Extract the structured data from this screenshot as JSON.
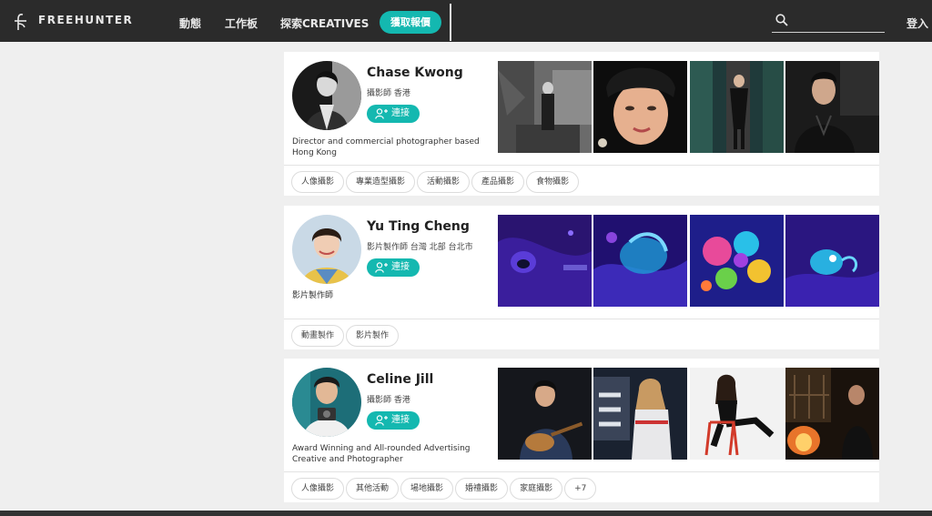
{
  "nav": {
    "brand": "FREEHUNTER",
    "links": [
      "動態",
      "工作板",
      "探索CREATIVES"
    ],
    "quote_button": "獲取報價",
    "search_placeholder": "",
    "login": "登入"
  },
  "profiles": [
    {
      "name": "Chase Kwong",
      "role": "攝影師 香港",
      "connect": "連接",
      "bio": "Director and commercial photographer based Hong Kong",
      "tags": [
        "人像攝影",
        "專業造型攝影",
        "活動攝影",
        "產品攝影",
        "食物攝影"
      ]
    },
    {
      "name": "Yu Ting Cheng",
      "role": "影片製作師 台灣 北部 台北市",
      "connect": "連接",
      "bio": "影片製作師",
      "tags": [
        "動畫製作",
        "影片製作"
      ]
    },
    {
      "name": "Celine Jill",
      "role": "攝影師 香港",
      "connect": "連接",
      "bio": "Award Winning and All-rounded Advertising Creative and Photographer",
      "tags": [
        "人像攝影",
        "其他活動",
        "場地攝影",
        "婚禮攝影",
        "家庭攝影",
        "+7"
      ]
    }
  ],
  "colors": {
    "accent": "#14b8b0",
    "nav_bg": "#2b2b2b",
    "page_bg": "#efefef"
  }
}
